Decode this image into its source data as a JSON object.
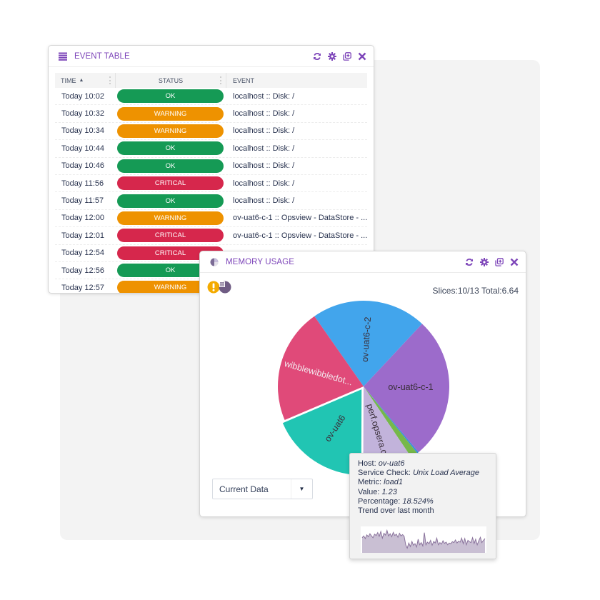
{
  "event_table": {
    "title": "EVENT TABLE",
    "icon": "list-icon",
    "actions": [
      "refresh-icon",
      "gear-icon",
      "popout-icon",
      "close-icon"
    ],
    "columns": {
      "time": "TIME",
      "status": "STATUS",
      "event": "EVENT"
    },
    "sort_indicator": "▲",
    "status_colors": {
      "OK": "#159a55",
      "WARNING": "#ee9200",
      "CRITICAL": "#d6274c"
    },
    "rows": [
      {
        "time": "Today 10:02",
        "status": "OK",
        "event": "localhost :: Disk: /"
      },
      {
        "time": "Today 10:32",
        "status": "WARNING",
        "event": "localhost :: Disk: /"
      },
      {
        "time": "Today 10:34",
        "status": "WARNING",
        "event": "localhost :: Disk: /"
      },
      {
        "time": "Today 10:44",
        "status": "OK",
        "event": "localhost :: Disk: /"
      },
      {
        "time": "Today 10:46",
        "status": "OK",
        "event": "localhost :: Disk: /"
      },
      {
        "time": "Today 11:56",
        "status": "CRITICAL",
        "event": "localhost :: Disk: /"
      },
      {
        "time": "Today 11:57",
        "status": "OK",
        "event": "localhost :: Disk: /"
      },
      {
        "time": "Today 12:00",
        "status": "WARNING",
        "event": "ov-uat6-c-1 :: Opsview - DataStore - ..."
      },
      {
        "time": "Today 12:01",
        "status": "CRITICAL",
        "event": "ov-uat6-c-1 :: Opsview - DataStore - ..."
      },
      {
        "time": "Today 12:54",
        "status": "CRITICAL",
        "event": ""
      },
      {
        "time": "Today 12:56",
        "status": "OK",
        "event": ""
      },
      {
        "time": "Today 12:57",
        "status": "WARNING",
        "event": ""
      }
    ]
  },
  "memory_usage": {
    "title": "MEMORY USAGE",
    "icon": "pie-chart-icon",
    "actions": [
      "refresh-icon",
      "gear-icon",
      "popout-icon",
      "close-icon"
    ],
    "alert_icon": "warning-exclamation-icon",
    "toggle_icon": "pie-list-toggle-icon",
    "slices_text": "Slices:10/13 Total:6.64",
    "dropdown": {
      "selected": "Current Data"
    }
  },
  "chart_data": {
    "type": "pie",
    "title": "MEMORY USAGE",
    "total": 6.64,
    "start_angle_deg": -35,
    "slices": [
      {
        "label": "ov-uat6-c-2",
        "value": 1.44,
        "color": "#42a5ec",
        "show_label": true
      },
      {
        "label": "ov-uat6-c-1",
        "value": 1.79,
        "color": "#9c6bcb",
        "show_label": true
      },
      {
        "label": "",
        "value": 0.02,
        "color": "#3b8fd9",
        "show_label": false
      },
      {
        "label": "",
        "value": 0.09,
        "color": "#76b84a",
        "show_label": false
      },
      {
        "label": "perf.opsera.co",
        "value": 0.63,
        "color": "#c2b3db",
        "show_label": true
      },
      {
        "label": "ov-uat6",
        "value": 1.23,
        "color": "#21c5b3",
        "show_label": true,
        "exploded": true
      },
      {
        "label": "wibblewibbledot...",
        "value": 1.44,
        "color": "#e04a79",
        "show_label": true,
        "light_label": true
      }
    ]
  },
  "tooltip": {
    "host_label": "Host:",
    "host": "ov-uat6",
    "check_label": "Service Check:",
    "check": "Unix Load Average",
    "metric_label": "Metric:",
    "metric": "load1",
    "value_label": "Value:",
    "value": "1.23",
    "percentage_label": "Percentage:",
    "percentage": "18.524%",
    "trend_label": "Trend over last month",
    "trend_values": [
      0.62,
      0.7,
      0.58,
      0.75,
      0.66,
      0.8,
      0.7,
      0.62,
      0.78,
      0.72,
      0.85,
      0.68,
      0.9,
      0.6,
      0.82,
      0.74,
      0.95,
      0.7,
      0.8,
      0.66,
      0.86,
      0.72,
      0.78,
      0.64,
      0.82,
      0.7,
      0.76,
      0.68,
      0.3,
      0.15,
      0.38,
      0.22,
      0.45,
      0.28,
      0.35,
      0.2,
      0.55,
      0.3,
      0.4,
      0.25,
      0.85,
      0.3,
      0.42,
      0.35,
      0.5,
      0.28,
      0.45,
      0.38,
      0.6,
      0.3,
      0.4,
      0.33,
      0.48,
      0.36,
      0.42,
      0.3,
      0.38,
      0.35,
      0.44,
      0.4,
      0.52,
      0.38,
      0.46,
      0.42,
      0.6,
      0.35,
      0.58,
      0.3,
      0.5,
      0.44,
      0.4,
      0.62,
      0.36,
      0.55,
      0.3,
      0.48,
      0.64,
      0.4,
      0.5,
      0.58
    ],
    "trend_color": "#8a739c",
    "trend_fill": "#c9bfd3"
  }
}
